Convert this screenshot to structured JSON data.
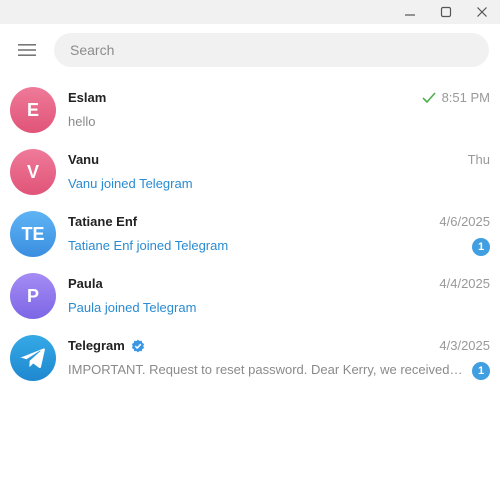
{
  "window": {
    "minimize_icon": "minimize-icon",
    "maximize_icon": "maximize-icon",
    "close_icon": "close-icon"
  },
  "header": {
    "menu_icon": "hamburger-menu-icon",
    "search_placeholder": "Search"
  },
  "chats": [
    {
      "initials": "E",
      "name": "Eslam",
      "time": "8:51 PM",
      "preview": "hello",
      "read_check": true,
      "unread": null,
      "verified": false,
      "accent": "#e05478"
    },
    {
      "initials": "V",
      "name": "Vanu",
      "time": "Thu",
      "preview": "Vanu joined Telegram",
      "read_check": false,
      "unread": null,
      "verified": false,
      "accent": "#e05478"
    },
    {
      "initials": "TE",
      "name": "Tatiane Enf",
      "time": "4/6/2025",
      "preview": "Tatiane Enf joined Telegram",
      "read_check": false,
      "unread": "1",
      "verified": false,
      "accent": "#3a8ee0"
    },
    {
      "initials": "P",
      "name": "Paula",
      "time": "4/4/2025",
      "preview": "Paula joined Telegram",
      "read_check": false,
      "unread": null,
      "verified": false,
      "accent": "#7d66e5"
    },
    {
      "initials": "",
      "name": "Telegram",
      "time": "4/3/2025",
      "preview": "IMPORTANT. Request to reset password.  Dear Kerry, we received a request to reset your password",
      "read_check": false,
      "unread": "1",
      "verified": true,
      "accent": "#1e88d0"
    }
  ],
  "colors": {
    "link": "#2a8bd0",
    "badge": "#3f9fe0",
    "check": "#4caf50"
  }
}
